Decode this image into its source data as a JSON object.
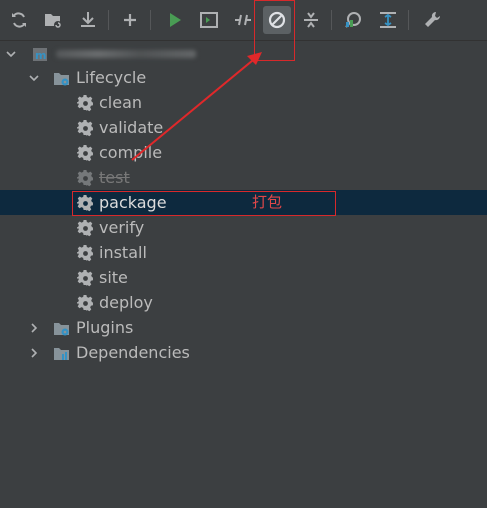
{
  "toolbar": {
    "buttons": [
      {
        "icon": "refresh-icon",
        "tooltip": "Reload All Maven Projects"
      },
      {
        "icon": "folder-sync-icon",
        "tooltip": "Generate Sources"
      },
      {
        "icon": "download-icon",
        "tooltip": "Download Sources"
      },
      {
        "icon": "plus-icon",
        "tooltip": "Add Maven Project"
      },
      {
        "icon": "run-icon",
        "tooltip": "Run Maven Build"
      },
      {
        "icon": "execute-goal-icon",
        "tooltip": "Execute Maven Goal"
      },
      {
        "icon": "toggle-offline-icon",
        "tooltip": "Toggle Offline Mode"
      },
      {
        "icon": "skip-tests-icon",
        "tooltip": "Toggle Skip Tests Mode",
        "active": true
      },
      {
        "icon": "collapse-all-icon",
        "tooltip": "Collapse All"
      },
      {
        "icon": "dependency-analyzer-icon",
        "tooltip": "Analyze Dependencies"
      },
      {
        "icon": "show-diagram-icon",
        "tooltip": "Show Dependencies"
      },
      {
        "icon": "wrench-settings-icon",
        "tooltip": "Maven Settings"
      }
    ]
  },
  "tree": {
    "project": {
      "label": ""
    },
    "lifecycle": {
      "label": "Lifecycle",
      "goals": [
        "clean",
        "validate",
        "compile",
        "test",
        "package",
        "verify",
        "install",
        "site",
        "deploy"
      ]
    },
    "plugins": {
      "label": "Plugins"
    },
    "dependencies": {
      "label": "Dependencies"
    }
  },
  "annotation": {
    "note": "打包",
    "color": "#d7292b"
  },
  "colors": {
    "background": "#3c3f41",
    "selection": "#0d293e",
    "run": "#499c54",
    "accent": "#3592c4"
  }
}
